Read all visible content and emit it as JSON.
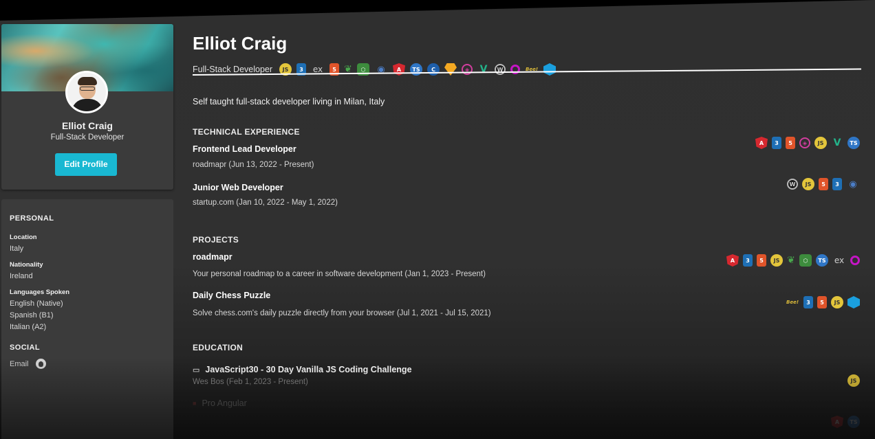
{
  "profile": {
    "name": "Elliot Craig",
    "role": "Full-Stack Developer",
    "edit_label": "Edit Profile"
  },
  "personal": {
    "title": "PERSONAL",
    "location_label": "Location",
    "location": "Italy",
    "nationality_label": "Nationality",
    "nationality": "Ireland",
    "languages_label": "Languages Spoken",
    "languages": [
      "English (Native)",
      "Spanish (B1)",
      "Italian (A2)"
    ]
  },
  "social": {
    "title": "SOCIAL",
    "email_label": "Email"
  },
  "main": {
    "name": "Elliot Craig",
    "role": "Full-Stack Developer",
    "bio": "Self taught full-stack developer living in Milan, Italy",
    "tech_icons": [
      "js",
      "css",
      "ex",
      "html",
      "mongo",
      "node",
      "eye",
      "ng",
      "ts",
      "c",
      "sketch",
      "gql",
      "vuetify",
      "wp",
      "oc",
      "bee",
      "cube"
    ]
  },
  "experience": {
    "title": "TECHNICAL EXPERIENCE",
    "items": [
      {
        "title": "Frontend Lead Developer",
        "sub": "roadmapr (Jun 13, 2022 - Present)",
        "icons": [
          "ng",
          "css",
          "html",
          "gql",
          "js",
          "vuetify",
          "ts"
        ]
      },
      {
        "title": "Junior Web Developer",
        "sub": "startup.com (Jan 10, 2022 - May 1, 2022)",
        "icons": [
          "wp",
          "js",
          "html",
          "css",
          "eye"
        ]
      }
    ]
  },
  "projects": {
    "title": "PROJECTS",
    "items": [
      {
        "title": "roadmapr",
        "sub": "Your personal roadmap to a career in software development (Jan 1, 2023 - Present)",
        "icons": [
          "ng",
          "css",
          "html",
          "js",
          "mongo",
          "node",
          "ts",
          "ex",
          "oc"
        ]
      },
      {
        "title": "Daily Chess Puzzle",
        "sub": "Solve chess.com's daily puzzle directly from your browser (Jul 1, 2021 - Jul 15, 2021)",
        "icons": [
          "bee",
          "css",
          "html",
          "js",
          "cube"
        ]
      }
    ]
  },
  "education": {
    "title": "EDUCATION",
    "items": [
      {
        "title": "JavaScript30 - 30 Day Vanilla JS Coding Challenge",
        "sub": "Wes Bos (Feb 1, 2023 - Present)",
        "icons": [
          "js"
        ]
      },
      {
        "title": "Pro Angular",
        "icons": [
          "ng",
          "ts"
        ]
      }
    ]
  },
  "icon_glyphs": {
    "js": "JS",
    "css": "3",
    "html": "5",
    "ex": "ex",
    "mongo": "❦",
    "node": "⬡",
    "eye": "◉",
    "ng": "A",
    "ts": "TS",
    "c": "C",
    "sketch": "",
    "gql": "◈",
    "vuetify": "V",
    "wp": "W",
    "oc": "",
    "bee": "Bee!",
    "cube": ""
  }
}
